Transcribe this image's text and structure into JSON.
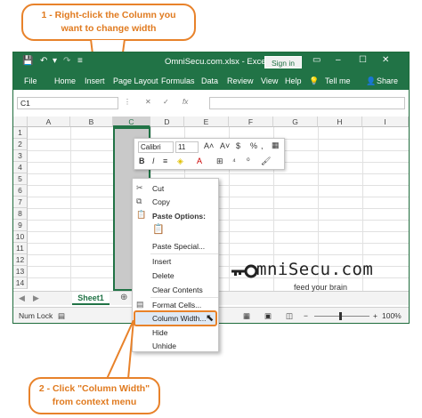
{
  "callouts": {
    "top_line1": "1 - Right-click the Column you",
    "top_line2": "want to change width",
    "bottom_line1": "2 - Click \"Column Width\"",
    "bottom_line2": "from context menu"
  },
  "window": {
    "title": "OmniSecu.com.xlsx  -  Excel",
    "sign_in": "Sign in",
    "colors": {
      "ribbon": "#217346",
      "accent": "#e8822a"
    }
  },
  "menu": {
    "file": "File",
    "home": "Home",
    "insert": "Insert",
    "page_layout": "Page Layout",
    "formulas": "Formulas",
    "data": "Data",
    "review": "Review",
    "view": "View",
    "help": "Help",
    "tell_me": "Tell me",
    "share": "Share"
  },
  "formula_bar": {
    "name_box": "C1",
    "fx": "fx"
  },
  "columns": [
    "A",
    "B",
    "C",
    "D",
    "E",
    "F",
    "G",
    "H",
    "I"
  ],
  "rows": [
    "1",
    "2",
    "3",
    "4",
    "5",
    "6",
    "7",
    "8",
    "9",
    "10",
    "11",
    "12",
    "13",
    "14"
  ],
  "sheet": {
    "tab": "Sheet1"
  },
  "status": {
    "mode": "Num Lock",
    "zoom": "100%"
  },
  "mini_toolbar": {
    "font": "Calibri",
    "size": "11"
  },
  "context_menu": {
    "cut": "Cut",
    "copy": "Copy",
    "paste_options": "Paste Options:",
    "paste_special": "Paste Special...",
    "insert": "Insert",
    "delete": "Delete",
    "clear_contents": "Clear Contents",
    "format_cells": "Format Cells...",
    "column_width": "Column Width...",
    "hide": "Hide",
    "unhide": "Unhide"
  },
  "logo": {
    "brand": "mniSecu.com",
    "tagline": "feed your brain"
  }
}
